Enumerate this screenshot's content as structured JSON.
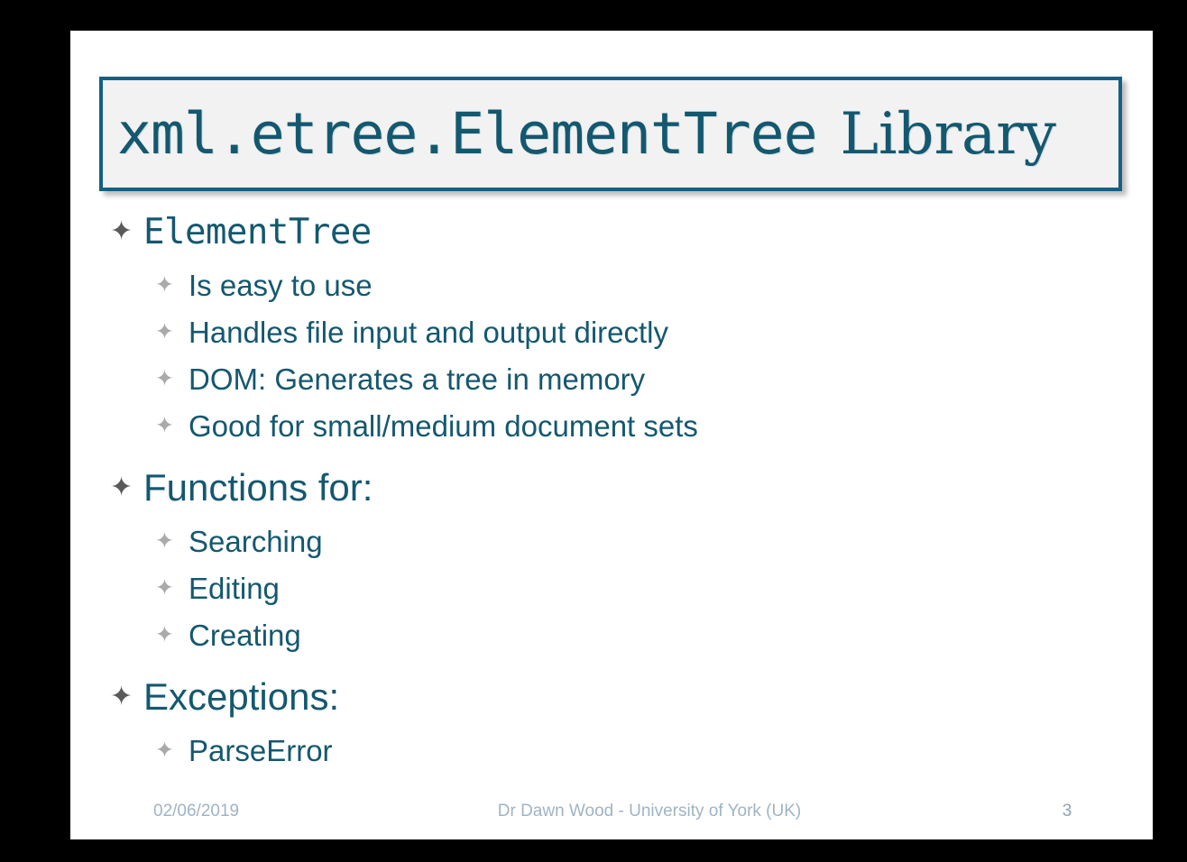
{
  "slide": {
    "title": {
      "mono_part": "xml.etree.ElementTree",
      "serif_part": "Library"
    },
    "bullet_marker": "✦",
    "accent_color": "#14586f",
    "title_border_color": "#136082",
    "title_fill_color": "#f2f2f2",
    "level1_marker_color": "#5a5a5a",
    "level2_marker_color": "#aaaaaa",
    "footer_color": "#9fb4c4",
    "content": [
      {
        "level": 1,
        "text": "ElementTree",
        "mono": true
      },
      {
        "level": 2,
        "text": "Is easy to use",
        "mono": false
      },
      {
        "level": 2,
        "text": "Handles file input and output directly",
        "mono": false
      },
      {
        "level": 2,
        "text": "DOM: Generates a tree in memory",
        "mono": false
      },
      {
        "level": 2,
        "text": "Good for small/medium document sets",
        "mono": false
      },
      {
        "level": 1,
        "text": "Functions for:",
        "mono": false
      },
      {
        "level": 2,
        "text": "Searching",
        "mono": false
      },
      {
        "level": 2,
        "text": "Editing",
        "mono": false
      },
      {
        "level": 2,
        "text": "Creating",
        "mono": false
      },
      {
        "level": 1,
        "text": "Exceptions:",
        "mono": false
      },
      {
        "level": 2,
        "text": "ParseError",
        "mono": false
      }
    ],
    "footer": {
      "date": "02/06/2019",
      "center": "Dr Dawn Wood - University of York (UK)",
      "page_number": "3"
    }
  }
}
